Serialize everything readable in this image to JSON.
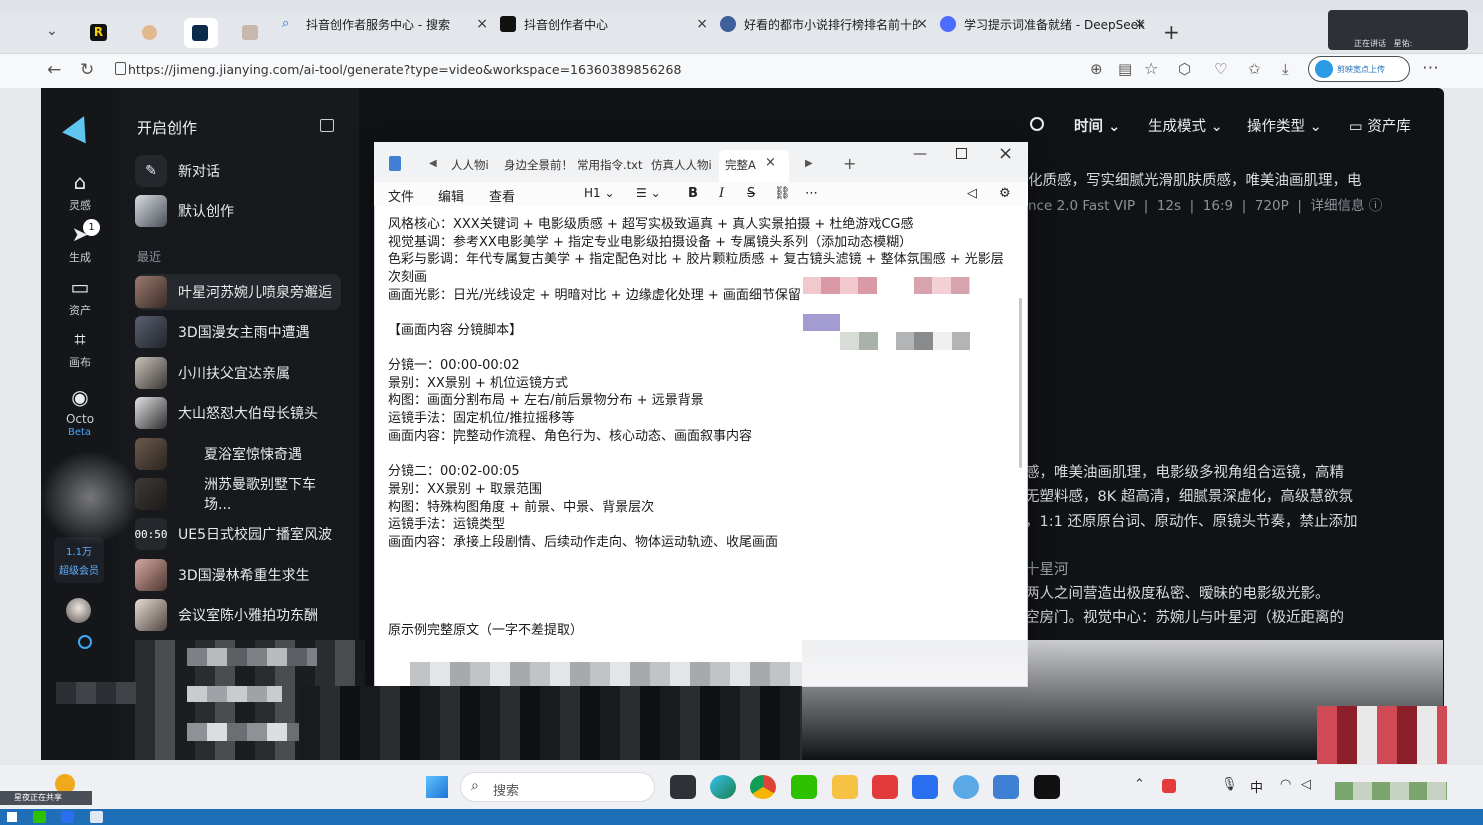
{
  "browser": {
    "tabs": [
      {
        "label": "抖音创作者服务中心 - 搜索",
        "icon": "search-icon"
      },
      {
        "label": "抖音创作者中心",
        "icon": "douyin-icon"
      },
      {
        "label": "好看的都市小说排行榜排名前十的",
        "icon": "avatar-icon"
      },
      {
        "label": "学习提示词准备就绪 - DeepSeek",
        "icon": "deepseek-icon"
      }
    ],
    "url": "https://jimeng.jianying.com/ai-tool/generate?type=video&workspace=16360389856268",
    "extension_label": "剪映宽点上传",
    "screen_share": {
      "label1": "正在讲话",
      "label2": "星佑:"
    }
  },
  "app": {
    "rail": [
      {
        "label": "灵感",
        "icon": "home-icon"
      },
      {
        "label": "生成",
        "icon": "generate-icon",
        "badge": "1"
      },
      {
        "label": "资产",
        "icon": "folder-icon"
      },
      {
        "label": "画布",
        "icon": "canvas-icon"
      },
      {
        "label": "Octo",
        "icon": "octo-icon",
        "tag": "Beta"
      }
    ],
    "vip": {
      "count": "1.1万",
      "label": "超级会员"
    },
    "sidebar": {
      "title": "开启创作",
      "new_chat": "新对话",
      "default_create": "默认创作",
      "recent_label": "最近",
      "items": [
        "叶星河苏婉儿喷泉旁邂逅",
        "3D国漫女主雨中遭遇",
        "小川扶父宜达亲属",
        "大山怒怼大伯母长镜头",
        "夏浴室惊悚奇遇",
        "洲苏曼歌别墅下车场...",
        "UE5日式校园广播室风波",
        "3D国漫林希重生求生",
        "会议室陈小雅拍功东酬"
      ],
      "time_badge": "00:50"
    },
    "toolbar": {
      "time": "时间",
      "gen_mode": "生成模式",
      "op_type": "操作类型",
      "assets": "资产库"
    },
    "detail_line1": "化质感，写实细腻光滑肌肤质感，唯美油画肌理，电",
    "detail_meta": [
      "nce 2.0 Fast VIP",
      "12s",
      "16:9",
      "720P",
      "详细信息"
    ],
    "prompt_lines": [
      "感，唯美油画肌理，电影级多视角组合运镜，高精",
      "无塑料感，8K 超高清，细腻景深虚化，高级慧欲氛",
      "，1:1 还原原台词、原动作、原镜头节奏，禁止添加"
    ],
    "prompt_name": "十星河",
    "prompt_lines2": [
      "两人之间营造出极度私密、暧昧的电影级光影。",
      "空房门。视觉中心：苏婉儿与叶星河（极近距离的"
    ]
  },
  "notepad": {
    "tabs": [
      "人人物i",
      "身边全景前！",
      "常用指令.txt",
      "仿真人人物i",
      "完整A"
    ],
    "menu": [
      "文件",
      "编辑",
      "查看"
    ],
    "heading": "H1",
    "lines": [
      "风格核心：XXX关键词 + 电影级质感 + 超写实极致逼真 + 真人实景拍摄 + 杜绝游戏CG感",
      "视觉基调：参考XX电影美学 + 指定专业电影级拍摄设备 + 专属镜头系列（添加动态模糊）",
      "色彩与影调：年代专属复古美学 + 指定配色对比 + 胶片颗粒质感 + 复古镜头滤镜 + 整体氛围感 + 光影层",
      "次刻画",
      "画面光影：日光/光线设定 + 明暗对比 + 边缘虚化处理 + 画面细节保留",
      "",
      "【画面内容 分镜脚本】",
      "",
      "分镜一：00:00-00:02",
      "景别：XX景别 + 机位运镜方式",
      "构图：画面分割布局 + 左右/前后景物分布 + 远景背景",
      "运镜手法：固定机位/推拉摇移等",
      "画面内容：完整动作流程、角色行为、核心动态、画面叙事内容",
      "",
      "分镜二：00:02-00:05",
      "景别：XX景别 + 取景范围",
      "构图：特殊构图角度 + 前景、中景、背景层次",
      "运镜手法：运镜类型",
      "画面内容：承接上段剧情、后续动作走向、物体运动轨迹、收尾画面"
    ],
    "footer_line": "原示例完整原文（一字不差提取）"
  },
  "taskbar": {
    "search_placeholder": "搜索",
    "tray_ime": "中",
    "share_label": "星夜正在共享"
  },
  "colors": {
    "accent": "#3b82f6",
    "app_bg": "#101216",
    "osbar": "#1f6fb8"
  }
}
